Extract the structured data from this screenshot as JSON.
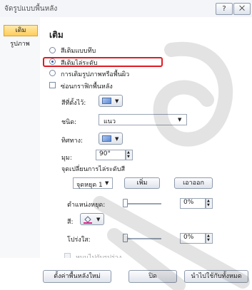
{
  "window": {
    "title": "จัดรูปแบบพื้นหลัง",
    "help_glyph": "?",
    "close_glyph": "⨉"
  },
  "sidebar": {
    "items": [
      {
        "label": "เติม",
        "active": true
      },
      {
        "label": "รูปภาพ",
        "active": false
      }
    ]
  },
  "fill": {
    "heading": "เติม",
    "options": [
      {
        "label": "สีเติมแบบทึบ",
        "selected": false
      },
      {
        "label": "สีเติมไล่ระดับ",
        "selected": true
      },
      {
        "label": "การเติมรูปภาพหรือพื้นผิว",
        "selected": false
      }
    ],
    "hide_graphics_label": "ซ่อนกราฟิกพื้นหลัง",
    "preset_colors_label": "สีที่ตั้งไว้:",
    "type_label": "ชนิด:",
    "type_value": "แนว",
    "direction_label": "ทิศทาง:",
    "angle_label": "มุม:",
    "angle_value": "90°",
    "stops_label": "จุดเปลี่ยนการไล่ระดับสี",
    "stop_value": "จุดหยุด 1",
    "add_button": "เพิ่ม",
    "remove_button": "เอาออก",
    "stop_position_label": "ตำแหน่งหยุด:",
    "stop_position_value": "0%",
    "color_label": "สี:",
    "transparency_label": "โปร่งใส:",
    "transparency_value": "0%",
    "rotate_with_shape_label": "หมุนไปกับรูปร่าง"
  },
  "footer": {
    "reset_button": "ตั้งค่าพื้นหลังใหม่",
    "close_button": "ปิด",
    "apply_all_button": "นำไปใช้กับทั้งหมด"
  },
  "colors": {
    "accent_highlight": "#e01b24",
    "selected_tab": "#ffcd5c"
  },
  "icons": {
    "color_button": "paint-bucket-icon",
    "dropdown": "chevron-down-icon"
  }
}
